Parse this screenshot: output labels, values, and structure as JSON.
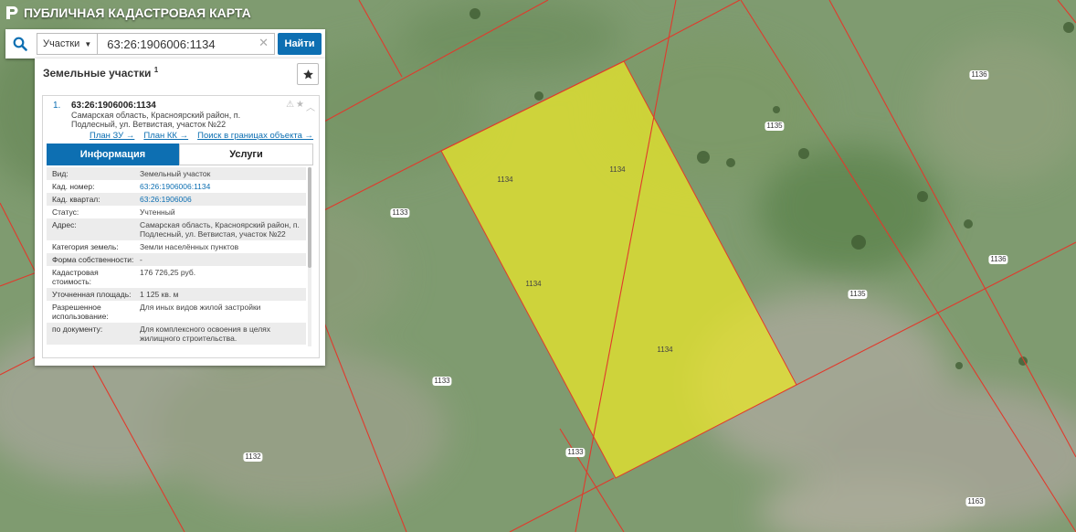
{
  "app": {
    "title": "ПУБЛИЧНАЯ КАДАСТРОВАЯ КАРТА"
  },
  "search": {
    "filter_label": "Участки",
    "query_value": "63:26:1906006:1134",
    "go_label": "Найти"
  },
  "panel": {
    "title": "Земельные участки",
    "count": "1",
    "result": {
      "index": "1.",
      "id": "63:26:1906006:1134",
      "address": "Самарская область, Красноярский район, п. Подлесный, ул. Ветвистая, участок №22",
      "links": [
        "План ЗУ →",
        "План КК →",
        "Поиск в границах объекта →"
      ],
      "tabs": [
        "Информация",
        "Услуги"
      ],
      "info": [
        {
          "k": "Вид:",
          "v": "Земельный участок"
        },
        {
          "k": "Кад. номер:",
          "v": "63:26:1906006:1134"
        },
        {
          "k": "Кад. квартал:",
          "v": "63:26:1906006"
        },
        {
          "k": "Статус:",
          "v": "Учтенный"
        },
        {
          "k": "Адрес:",
          "v": "Самарская область, Красноярский район, п. Подлесный, ул. Ветвистая, участок №22"
        },
        {
          "k": "Категория земель:",
          "v": "Земли населённых пунктов"
        },
        {
          "k": "Форма собственности:",
          "v": "-"
        },
        {
          "k": "Кадастровая стоимость:",
          "v": "176 726,25 руб."
        },
        {
          "k": "Уточненная площадь:",
          "v": "1 125 кв. м"
        },
        {
          "k": "Разрешенное использование:",
          "v": "Для иных видов жилой застройки"
        },
        {
          "k": "по документу:",
          "v": "Для комплексного освоения в целях жилищного строительства."
        }
      ]
    }
  },
  "map": {
    "labels": [
      "1136",
      "1135",
      "1134",
      "1134",
      "1133",
      "1134",
      "1134",
      "1136",
      "1135",
      "1133",
      "1132",
      "1133",
      "1163"
    ]
  }
}
